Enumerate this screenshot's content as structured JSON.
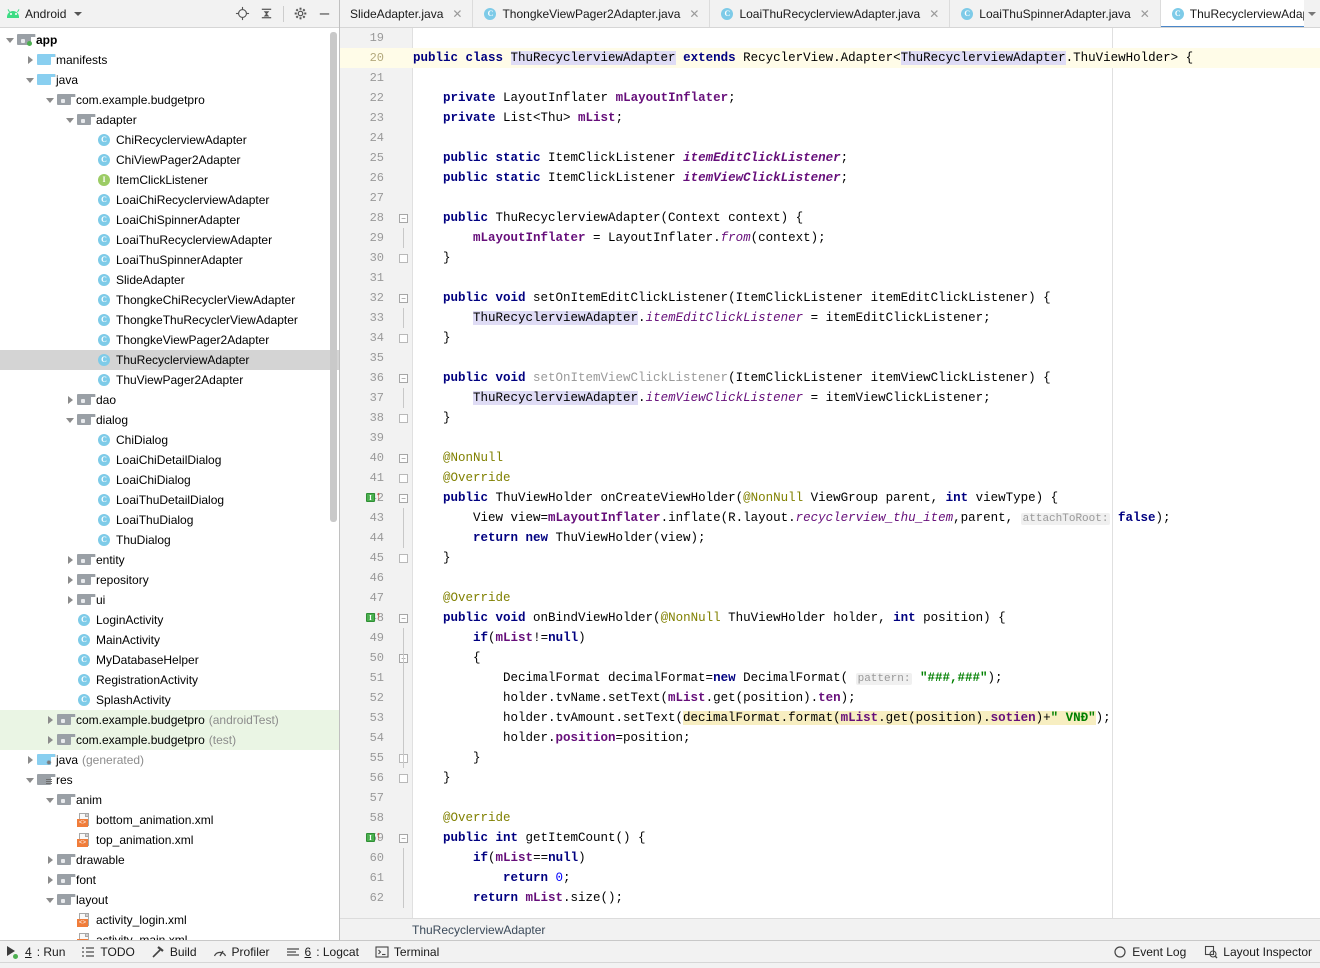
{
  "project_panel": {
    "title": "Android",
    "icons": [
      "android-icon",
      "chevron-down-icon",
      "locate-icon",
      "collapse-all-icon",
      "gear-icon",
      "minimize-icon"
    ],
    "tree": [
      {
        "label": "app",
        "kind": "module",
        "indent": 0,
        "arrow": "down",
        "bold": true,
        "badge": "dot"
      },
      {
        "label": "manifests",
        "kind": "folder-blue",
        "indent": 1,
        "arrow": "right"
      },
      {
        "label": "java",
        "kind": "folder-blue",
        "indent": 1,
        "arrow": "down"
      },
      {
        "label": "com.example.budgetpro",
        "kind": "package",
        "indent": 2,
        "arrow": "down"
      },
      {
        "label": "adapter",
        "kind": "package",
        "indent": 3,
        "arrow": "down"
      },
      {
        "label": "ChiRecyclerviewAdapter",
        "kind": "class",
        "indent": 4
      },
      {
        "label": "ChiViewPager2Adapter",
        "kind": "class",
        "indent": 4
      },
      {
        "label": "ItemClickListener",
        "kind": "interface",
        "indent": 4
      },
      {
        "label": "LoaiChiRecyclerviewAdapter",
        "kind": "class",
        "indent": 4
      },
      {
        "label": "LoaiChiSpinnerAdapter",
        "kind": "class",
        "indent": 4
      },
      {
        "label": "LoaiThuRecyclerviewAdapter",
        "kind": "class",
        "indent": 4
      },
      {
        "label": "LoaiThuSpinnerAdapter",
        "kind": "class",
        "indent": 4
      },
      {
        "label": "SlideAdapter",
        "kind": "class",
        "indent": 4
      },
      {
        "label": "ThongkeChiRecyclerViewAdapter",
        "kind": "class",
        "indent": 4
      },
      {
        "label": "ThongkeThuRecyclerViewAdapter",
        "kind": "class",
        "indent": 4
      },
      {
        "label": "ThongkeViewPager2Adapter",
        "kind": "class",
        "indent": 4
      },
      {
        "label": "ThuRecyclerviewAdapter",
        "kind": "class",
        "indent": 4,
        "selected": true
      },
      {
        "label": "ThuViewPager2Adapter",
        "kind": "class",
        "indent": 4
      },
      {
        "label": "dao",
        "kind": "package",
        "indent": 3,
        "arrow": "right"
      },
      {
        "label": "dialog",
        "kind": "package",
        "indent": 3,
        "arrow": "down"
      },
      {
        "label": "ChiDialog",
        "kind": "class",
        "indent": 4
      },
      {
        "label": "LoaiChiDetailDialog",
        "kind": "class",
        "indent": 4
      },
      {
        "label": "LoaiChiDialog",
        "kind": "class",
        "indent": 4
      },
      {
        "label": "LoaiThuDetailDialog",
        "kind": "class",
        "indent": 4
      },
      {
        "label": "LoaiThuDialog",
        "kind": "class",
        "indent": 4
      },
      {
        "label": "ThuDialog",
        "kind": "class",
        "indent": 4
      },
      {
        "label": "entity",
        "kind": "package",
        "indent": 3,
        "arrow": "right"
      },
      {
        "label": "repository",
        "kind": "package",
        "indent": 3,
        "arrow": "right"
      },
      {
        "label": "ui",
        "kind": "package",
        "indent": 3,
        "arrow": "right"
      },
      {
        "label": "LoginActivity",
        "kind": "class",
        "indent": 3
      },
      {
        "label": "MainActivity",
        "kind": "class",
        "indent": 3
      },
      {
        "label": "MyDatabaseHelper",
        "kind": "class",
        "indent": 3
      },
      {
        "label": "RegistrationActivity",
        "kind": "class",
        "indent": 3
      },
      {
        "label": "SplashActivity",
        "kind": "class",
        "indent": 3
      },
      {
        "label": "com.example.budgetpro",
        "suffix": "(androidTest)",
        "kind": "package",
        "indent": 2,
        "arrow": "right",
        "test": true
      },
      {
        "label": "com.example.budgetpro",
        "suffix": "(test)",
        "kind": "package",
        "indent": 2,
        "arrow": "right",
        "test": true
      },
      {
        "label": "java",
        "suffix": "(generated)",
        "kind": "folder-gen",
        "indent": 1,
        "arrow": "right"
      },
      {
        "label": "res",
        "kind": "folder-res",
        "indent": 1,
        "arrow": "down"
      },
      {
        "label": "anim",
        "kind": "package",
        "indent": 2,
        "arrow": "down"
      },
      {
        "label": "bottom_animation.xml",
        "kind": "xml",
        "indent": 3
      },
      {
        "label": "top_animation.xml",
        "kind": "xml",
        "indent": 3
      },
      {
        "label": "drawable",
        "kind": "package",
        "indent": 2,
        "arrow": "right"
      },
      {
        "label": "font",
        "kind": "package",
        "indent": 2,
        "arrow": "right"
      },
      {
        "label": "layout",
        "kind": "package",
        "indent": 2,
        "arrow": "down"
      },
      {
        "label": "activity_login.xml",
        "kind": "xml",
        "indent": 3
      },
      {
        "label": "activity_main.xml",
        "kind": "xml",
        "indent": 3
      }
    ]
  },
  "tabs": [
    {
      "label": "SlideAdapter.java",
      "icon": false,
      "active": false
    },
    {
      "label": "ThongkeViewPager2Adapter.java",
      "icon": true,
      "active": false
    },
    {
      "label": "LoaiThuRecyclerviewAdapter.java",
      "icon": true,
      "active": false
    },
    {
      "label": "LoaiThuSpinnerAdapter.java",
      "icon": true,
      "active": false
    },
    {
      "label": "ThuRecyclerviewAdapter.java",
      "icon": true,
      "active": true
    }
  ],
  "editor": {
    "first_line": 19,
    "caret_line": 20,
    "breadcrumb": "ThuRecyclerviewAdapter",
    "lines": [
      {
        "n": 19,
        "html": ""
      },
      {
        "n": 20,
        "caret": true,
        "html": "<span class=\"kw\">public class </span><span class=\"idhl\">ThuRecyclerviewAdapter</span><span class=\"kw\"> extends </span><span class=\"pln\">RecyclerView.Adapter&lt;</span><span class=\"idhl\">ThuRecyclerviewAdapter</span><span class=\"pln\">.ThuViewHolder&gt; {</span>"
      },
      {
        "n": 21,
        "html": ""
      },
      {
        "n": 22,
        "html": "    <span class=\"kw\">private </span><span class=\"pln\">LayoutInflater </span><span class=\"fld\">mLayoutInflater</span><span class=\"pln\">;</span>"
      },
      {
        "n": 23,
        "html": "    <span class=\"kw\">private </span><span class=\"pln\">List&lt;Thu&gt; </span><span class=\"fld\">mList</span><span class=\"pln\">;</span>"
      },
      {
        "n": 24,
        "html": ""
      },
      {
        "n": 25,
        "html": "    <span class=\"kw\">public static </span><span class=\"pln\">ItemClickListener </span><span class=\"statb\">itemEditClickListener</span><span class=\"pln\">;</span>"
      },
      {
        "n": 26,
        "html": "    <span class=\"kw\">public static </span><span class=\"pln\">ItemClickListener </span><span class=\"statb\">itemViewClickListener</span><span class=\"pln\">;</span>"
      },
      {
        "n": 27,
        "html": ""
      },
      {
        "n": 28,
        "fold": "minus",
        "html": "    <span class=\"kw\">public </span><span class=\"pln\">ThuRecyclerviewAdapter(Context context) {</span>"
      },
      {
        "n": 29,
        "bar": true,
        "html": "        <span class=\"fld\">mLayoutInflater</span><span class=\"pln\"> = LayoutInflater.</span><span class=\"stat\">from</span><span class=\"pln\">(context);</span>"
      },
      {
        "n": 30,
        "fold": "end",
        "html": "    <span class=\"pln\">}</span>"
      },
      {
        "n": 31,
        "html": ""
      },
      {
        "n": 32,
        "fold": "minus",
        "html": "    <span class=\"kw\">public void </span><span class=\"pln\">setOnItemEditClickListener(ItemClickListener itemEditClickListener) {</span>"
      },
      {
        "n": 33,
        "bar": true,
        "html": "        <span class=\"idhl\">ThuRecyclerviewAdapter</span><span class=\"pln\">.</span><span class=\"stat\">itemEditClickListener</span><span class=\"pln\"> = itemEditClickListener;</span>"
      },
      {
        "n": 34,
        "fold": "end",
        "html": "    <span class=\"pln\">}</span>"
      },
      {
        "n": 35,
        "html": ""
      },
      {
        "n": 36,
        "fold": "minus",
        "html": "    <span class=\"kw\">public void </span><span class=\"unused\">setOnItemViewClickListener</span><span class=\"pln\">(ItemClickListener itemViewClickListener) {</span>"
      },
      {
        "n": 37,
        "bar": true,
        "html": "        <span class=\"idhl\">ThuRecyclerviewAdapter</span><span class=\"pln\">.</span><span class=\"stat\">itemViewClickListener</span><span class=\"pln\"> = itemViewClickListener;</span>"
      },
      {
        "n": 38,
        "fold": "end",
        "html": "    <span class=\"pln\">}</span>"
      },
      {
        "n": 39,
        "html": ""
      },
      {
        "n": 40,
        "fold": "minus",
        "html": "    <span class=\"ann\">@NonNull</span>"
      },
      {
        "n": 41,
        "fold": "end",
        "html": "    <span class=\"ann\">@Override</span>"
      },
      {
        "n": 42,
        "override": true,
        "fold": "minus",
        "html": "    <span class=\"kw\">public </span><span class=\"pln\">ThuViewHolder onCreateViewHolder(</span><span class=\"ann\">@NonNull</span><span class=\"pln\"> ViewGroup parent, </span><span class=\"kw\">int </span><span class=\"pln\">viewType) {</span>"
      },
      {
        "n": 43,
        "bar": true,
        "html": "        <span class=\"pln\">View view=</span><span class=\"fld\">mLayoutInflater</span><span class=\"pln\">.inflate(R.layout.</span><span class=\"stat\">recyclerview_thu_item</span><span class=\"pln\">,parent, </span><span class=\"hint\">attachToRoot:</span><span class=\"pln\"> </span><span class=\"kw\">false</span><span class=\"pln\">);</span>"
      },
      {
        "n": 44,
        "bar": true,
        "html": "        <span class=\"kw\">return new </span><span class=\"pln\">ThuViewHolder(view);</span>"
      },
      {
        "n": 45,
        "fold": "end",
        "html": "    <span class=\"pln\">}</span>"
      },
      {
        "n": 46,
        "html": ""
      },
      {
        "n": 47,
        "html": "    <span class=\"ann\">@Override</span>"
      },
      {
        "n": 48,
        "override": true,
        "fold": "minus",
        "html": "    <span class=\"kw\">public void </span><span class=\"pln\">onBindViewHolder(</span><span class=\"ann\">@NonNull</span><span class=\"pln\"> ThuViewHolder holder, </span><span class=\"kw\">int </span><span class=\"pln\">position) {</span>"
      },
      {
        "n": 49,
        "bar": true,
        "html": "        <span class=\"kw\">if</span><span class=\"pln\">(</span><span class=\"fld\">mList</span><span class=\"pln\">!=</span><span class=\"kw\">null</span><span class=\"pln\">)</span>"
      },
      {
        "n": 50,
        "fold": "minus",
        "bar": true,
        "html": "        <span class=\"pln\">{</span>"
      },
      {
        "n": 51,
        "bar": true,
        "html": "            <span class=\"pln\">DecimalFormat decimalFormat=</span><span class=\"kw\">new </span><span class=\"pln\">DecimalFormat( </span><span class=\"hint\">pattern:</span><span class=\"pln\"> </span><span class=\"str\">\"###,###\"</span><span class=\"pln\">);</span>"
      },
      {
        "n": 52,
        "bar": true,
        "html": "            <span class=\"pln\">holder.tvName.setText(</span><span class=\"fld\">mList</span><span class=\"pln\">.get(position).</span><span class=\"fld\">ten</span><span class=\"pln\">);</span>"
      },
      {
        "n": 53,
        "bar": true,
        "html": "            <span class=\"pln\">holder.tvAmount.setText(</span><span class=\"selhl\">decimalFormat.format(</span><span class=\"selhl fld\">mList</span><span class=\"selhl\">.get(position).</span><span class=\"selhl fld\">sotien</span><span class=\"selhl\">)+</span><span class=\"selhl str\">\" VNĐ\"</span><span class=\"pln\">);</span>"
      },
      {
        "n": 54,
        "bar": true,
        "html": "            <span class=\"pln\">holder.</span><span class=\"fld\">position</span><span class=\"pln\">=position;</span>"
      },
      {
        "n": 55,
        "fold": "end",
        "bar": true,
        "html": "        <span class=\"pln\">}</span>"
      },
      {
        "n": 56,
        "fold": "end",
        "html": "    <span class=\"pln\">}</span>"
      },
      {
        "n": 57,
        "html": ""
      },
      {
        "n": 58,
        "html": "    <span class=\"ann\">@Override</span>"
      },
      {
        "n": 59,
        "override": true,
        "fold": "minus",
        "html": "    <span class=\"kw\">public int </span><span class=\"pln\">getItemCount() {</span>"
      },
      {
        "n": 60,
        "bar": true,
        "html": "        <span class=\"kw\">if</span><span class=\"pln\">(</span><span class=\"fld\">mList</span><span class=\"pln\">==</span><span class=\"kw\">null</span><span class=\"pln\">)</span>"
      },
      {
        "n": 61,
        "bar": true,
        "html": "            <span class=\"kw\">return </span><span class=\"num\">0</span><span class=\"pln\">;</span>"
      },
      {
        "n": 62,
        "bar": true,
        "html": "        <span class=\"kw\">return </span><span class=\"fld\">mList</span><span class=\"pln\">.size();</span>"
      }
    ]
  },
  "tool_window_bar": {
    "left": [
      {
        "label_pre": "4",
        "label": ": Run",
        "icon": "run-icon"
      },
      {
        "label": "TODO",
        "icon": "todo-icon"
      },
      {
        "label": "Build",
        "icon": "build-hammer-icon"
      },
      {
        "label": "Profiler",
        "icon": "profiler-icon"
      },
      {
        "label_pre": "6",
        "label": ": Logcat",
        "icon": "logcat-icon"
      },
      {
        "label": "Terminal",
        "icon": "terminal-icon"
      }
    ],
    "right": [
      {
        "label": "Event Log",
        "icon": "event-log-icon"
      },
      {
        "label": "Layout Inspector",
        "icon": "layout-inspector-icon"
      }
    ]
  }
}
